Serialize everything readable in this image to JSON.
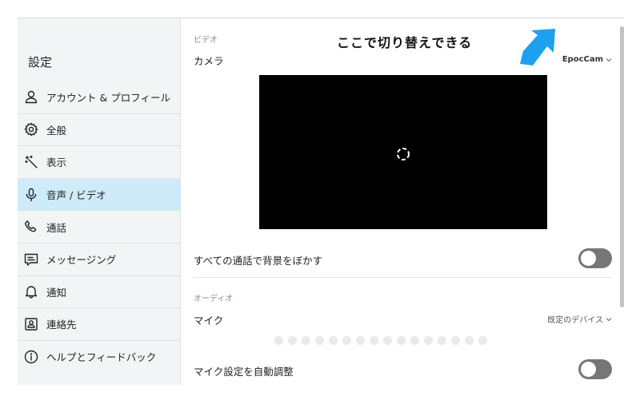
{
  "sidebar": {
    "title": "設定",
    "items": [
      {
        "label": "アカウント & プロフィール",
        "icon": "person-icon",
        "active": false
      },
      {
        "label": "全般",
        "icon": "gear-icon",
        "active": false
      },
      {
        "label": "表示",
        "icon": "magic-wand-icon",
        "active": false
      },
      {
        "label": "音声 / ビデオ",
        "icon": "microphone-icon",
        "active": true
      },
      {
        "label": "通話",
        "icon": "phone-icon",
        "active": false
      },
      {
        "label": "メッセージング",
        "icon": "message-icon",
        "active": false
      },
      {
        "label": "通知",
        "icon": "bell-icon",
        "active": false
      },
      {
        "label": "連絡先",
        "icon": "contact-card-icon",
        "active": false
      },
      {
        "label": "ヘルプとフィードバック",
        "icon": "info-icon",
        "active": false
      }
    ]
  },
  "video": {
    "section_label": "ビデオ",
    "camera_label": "カメラ",
    "camera_value": "EpocCam",
    "blur_label": "すべての通話で背景をぼかす",
    "blur_enabled": false
  },
  "audio": {
    "section_label": "オーディオ",
    "mic_label": "マイク",
    "mic_value": "既定のデバイス",
    "mic_level_dots": 16,
    "auto_adjust_label": "マイク設定を自動調整",
    "auto_adjust_enabled": false
  },
  "annotation": {
    "text": "ここで切り替えできる",
    "arrow_color": "#1ea0f0"
  },
  "colors": {
    "active_nav": "#cdebf8",
    "toggle_off": "#767676"
  }
}
